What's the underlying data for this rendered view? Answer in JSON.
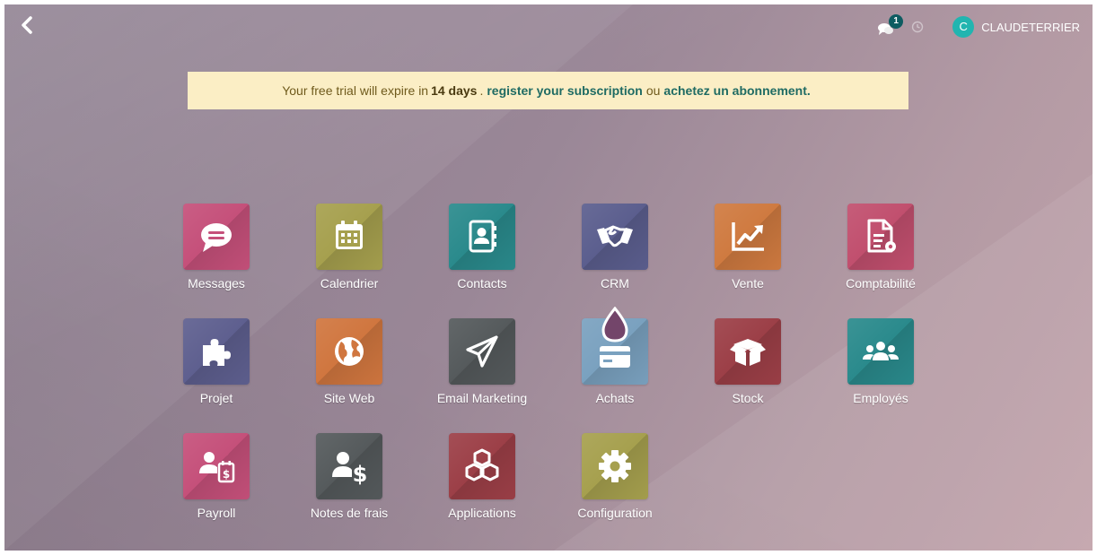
{
  "topbar": {
    "back_icon": "chevron-left-icon",
    "messages_badge": "1",
    "user_initial": "C",
    "user_name": "CLAUDETERRIER",
    "avatar_color": "#21b5b0"
  },
  "trial_banner": {
    "text_before": "Your free trial will expire in",
    "days": "14 days",
    "sep": ".",
    "register_link": "register your subscription",
    "ou": "ou",
    "buy_link": "achetez un abonnement."
  },
  "apps": [
    {
      "label": "Messages",
      "icon": "chat-bubble-icon",
      "color": "#c5507a"
    },
    {
      "label": "Calendrier",
      "icon": "calendar-icon",
      "color": "#a6a04e"
    },
    {
      "label": "Contacts",
      "icon": "address-book-icon",
      "color": "#2a8a8c"
    },
    {
      "label": "CRM",
      "icon": "handshake-icon",
      "color": "#5b5e8e"
    },
    {
      "label": "Vente",
      "icon": "trend-chart-icon",
      "color": "#cf7a40"
    },
    {
      "label": "Comptabilité",
      "icon": "invoice-icon",
      "color": "#c14f6e"
    },
    {
      "label": "Projet",
      "icon": "puzzle-icon",
      "color": "#5e5f8f"
    },
    {
      "label": "Site Web",
      "icon": "globe-icon",
      "color": "#d0763f"
    },
    {
      "label": "Email Marketing",
      "icon": "paper-plane-icon",
      "color": "#555a5c"
    },
    {
      "label": "Achats",
      "icon": "credit-card-icon",
      "color": "#7aa1bf"
    },
    {
      "label": "Stock",
      "icon": "box-icon",
      "color": "#9c3f47"
    },
    {
      "label": "Employés",
      "icon": "users-icon",
      "color": "#2a8a8c"
    },
    {
      "label": "Payroll",
      "icon": "user-payslip-icon",
      "color": "#c5507a"
    },
    {
      "label": "Notes de frais",
      "icon": "user-dollar-icon",
      "color": "#555a5c"
    },
    {
      "label": "Applications",
      "icon": "cubes-icon",
      "color": "#9c3f47"
    },
    {
      "label": "Configuration",
      "icon": "cog-icon",
      "color": "#a6a04e"
    }
  ]
}
